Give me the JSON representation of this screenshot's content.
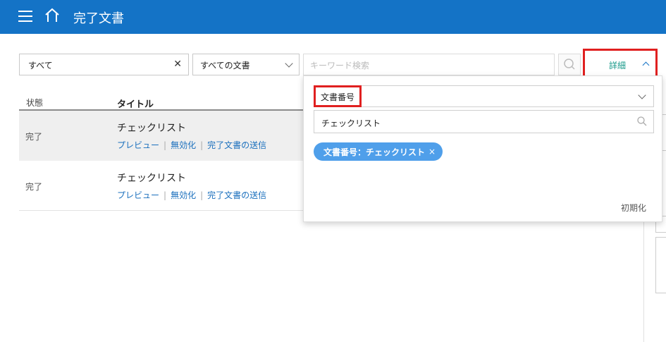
{
  "header": {
    "title": "完了文書"
  },
  "filters": {
    "status_value": "すべて",
    "clear_symbol": "✕",
    "doc_type_value": "すべての文書",
    "keyword_placeholder": "キーワード検索",
    "detail_label": "詳細"
  },
  "table": {
    "columns": {
      "status": "状態",
      "title": "タイトル"
    },
    "rows": [
      {
        "status": "完了",
        "title": "チェックリスト",
        "links": [
          "プレビュー",
          "無効化",
          "完了文書の送信"
        ]
      },
      {
        "status": "完了",
        "title": "チェックリスト",
        "links": [
          "プレビュー",
          "無効化",
          "完了文書の送信"
        ]
      }
    ]
  },
  "detail_panel": {
    "field_select_value": "文書番号",
    "field_input_value": "チェックリスト",
    "chip_label": "文書番号：チェックリスト",
    "chip_remove": "×",
    "reset_label": "初期化"
  },
  "colors": {
    "header_bg": "#1473c6",
    "highlight": "#e02020",
    "link": "#1a6fbd",
    "chip_bg": "#4f9fea"
  }
}
